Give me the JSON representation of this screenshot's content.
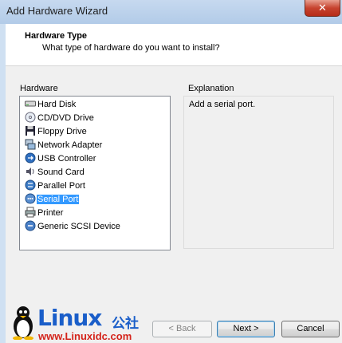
{
  "window": {
    "title": "Add Hardware Wizard",
    "close_glyph": "✕"
  },
  "header": {
    "title": "Hardware Type",
    "subtitle": "What type of hardware do you want to install?"
  },
  "hardware": {
    "label": "Hardware",
    "selected_index": 7,
    "items": [
      {
        "label": "Hard Disk",
        "icon": "hard-disk-icon"
      },
      {
        "label": "CD/DVD Drive",
        "icon": "cd-dvd-drive-icon"
      },
      {
        "label": "Floppy Drive",
        "icon": "floppy-drive-icon"
      },
      {
        "label": "Network Adapter",
        "icon": "network-adapter-icon"
      },
      {
        "label": "USB Controller",
        "icon": "usb-controller-icon"
      },
      {
        "label": "Sound Card",
        "icon": "sound-card-icon"
      },
      {
        "label": "Parallel Port",
        "icon": "parallel-port-icon"
      },
      {
        "label": "Serial Port",
        "icon": "serial-port-icon"
      },
      {
        "label": "Printer",
        "icon": "printer-icon"
      },
      {
        "label": "Generic SCSI Device",
        "icon": "scsi-device-icon"
      }
    ]
  },
  "explanation": {
    "label": "Explanation",
    "text": "Add a serial port."
  },
  "buttons": {
    "back": "< Back",
    "next": "Next >",
    "cancel": "Cancel"
  },
  "watermark": {
    "brand": "Linux",
    "brand_cn": "公社",
    "url": "www.Linuxidc.com"
  },
  "colors": {
    "selection": "#3399ff",
    "watermark_blue": "#1a5ec9",
    "watermark_red": "#d4241b"
  }
}
